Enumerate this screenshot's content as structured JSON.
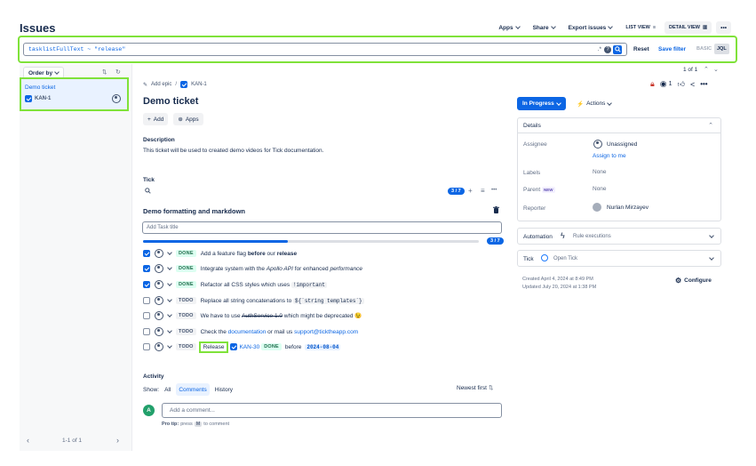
{
  "header": {
    "title": "Issues",
    "buttons": {
      "apps": "Apps",
      "share": "Share",
      "export": "Export issues",
      "list_view": "LIST VIEW",
      "detail_view": "DETAIL VIEW"
    }
  },
  "search": {
    "query": "tasklistFullText ~ \"release\"",
    "reset": "Reset",
    "save_filter": "Save filter",
    "basic": "BASIC",
    "jql": "JQL"
  },
  "left_panel": {
    "order_by": "Order by",
    "items": [
      {
        "title": "Demo ticket",
        "key": "KAN-1"
      }
    ],
    "pagination": "1-1 of 1"
  },
  "pager": "1 of 1",
  "issue": {
    "add_epic": "Add epic",
    "breadcrumb_key": "KAN-1",
    "title": "Demo ticket",
    "add_button": "Add",
    "apps_button": "Apps",
    "description_label": "Description",
    "description": "This ticket will be used to created demo videos for Tick documentation.",
    "watchers": "1"
  },
  "tick": {
    "label": "Tick",
    "badge": "3 / 7",
    "checklist_title": "Demo formatting and markdown",
    "add_placeholder": "Add Task title",
    "progress_label": "3 / 7",
    "progress": 0.43,
    "tasks": [
      {
        "checked": true,
        "status": "DONE",
        "before": "Add a feature flag ",
        "bold": "before",
        "middle": " our ",
        "bold2": "release"
      },
      {
        "checked": true,
        "status": "DONE",
        "before": "Integrate system with the ",
        "italic": "Apollo API",
        "after": " for enhanced ",
        "italic2": "performance"
      },
      {
        "checked": true,
        "status": "DONE",
        "before": "Refactor all CSS styles which uses ",
        "code": "!important"
      },
      {
        "checked": false,
        "status": "TODO",
        "before": "Replace all string concatenations to ",
        "code": "${`string templates`}"
      },
      {
        "checked": false,
        "status": "TODO",
        "before": "We have to use ",
        "strike": "AuthService 1.0",
        "after": " which might be deprecated",
        "emoji": "😉"
      },
      {
        "checked": false,
        "status": "TODO",
        "before": "Check the ",
        "link1": "documentation",
        "middle": " or mail us ",
        "link2": "support@ticktheapp.com"
      },
      {
        "checked": false,
        "status": "TODO",
        "release": "Release",
        "issue_key": "KAN-30",
        "issue_status": "DONE",
        "before": "before",
        "date": "2024-08-04"
      }
    ]
  },
  "activity": {
    "label": "Activity",
    "show": "Show:",
    "tabs": [
      "All",
      "Comments",
      "History"
    ],
    "sort": "Newest first",
    "comment_placeholder": "Add a comment...",
    "avatar_letter": "A",
    "pro_tip": "Pro tip:",
    "pro_tip_rest": "press",
    "pro_tip_key": "M",
    "pro_tip_end": "to comment"
  },
  "sidebar": {
    "status_button": "In Progress",
    "actions": "Actions",
    "details_label": "Details",
    "assignee_label": "Assignee",
    "assignee_value": "Unassigned",
    "assign_to_me": "Assign to me",
    "labels_label": "Labels",
    "labels_value": "None",
    "parent_label": "Parent",
    "parent_badge": "NEW",
    "parent_value": "None",
    "reporter_label": "Reporter",
    "reporter_value": "Nurlan Mirzayev",
    "automation_label": "Automation",
    "automation_value": "Rule executions",
    "tick_label": "Tick",
    "tick_value": "Open Tick",
    "created": "Created April 4, 2024 at 8:49 PM",
    "updated": "Updated July 20, 2024 at 1:38 PM",
    "configure": "Configure"
  },
  "colors": {
    "accent": "#0c66e4",
    "highlight": "#7fe23a",
    "done_bg": "#dcfff1",
    "done_text": "#216e4e"
  }
}
